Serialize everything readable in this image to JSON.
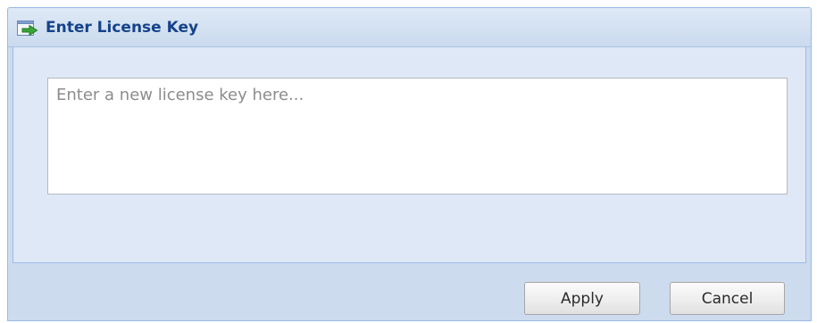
{
  "dialog": {
    "title": "Enter License Key",
    "title_icon": "green-arrow-into-box-icon",
    "license_key": {
      "value": "",
      "placeholder": "Enter a new license key here..."
    },
    "buttons": {
      "apply_label": "Apply",
      "cancel_label": "Cancel"
    }
  },
  "colors": {
    "title_text": "#15428b",
    "frame": "#cddbef",
    "body": "#dfe8f6",
    "border": "#99bbe8",
    "icon_arrow": "#2f9e2f"
  }
}
